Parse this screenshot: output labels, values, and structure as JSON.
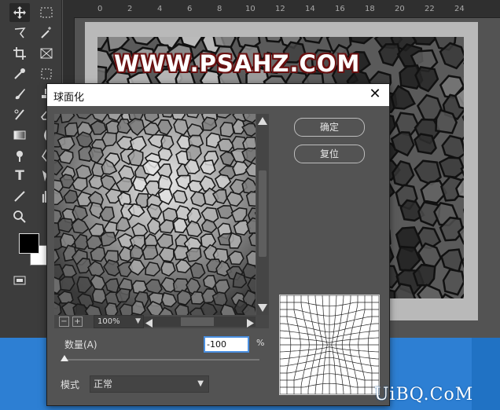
{
  "ruler": {
    "ticks": [
      "0",
      "2",
      "4",
      "6",
      "8",
      "10",
      "12",
      "14",
      "16",
      "18",
      "20",
      "22",
      "24"
    ]
  },
  "document": {
    "watermark": "WWW.PSAHZ.COM"
  },
  "dialog": {
    "title": "球面化",
    "close_label": "✕",
    "ok_label": "确定",
    "reset_label": "复位",
    "zoom_minus": "−",
    "zoom_plus": "+",
    "zoom_value": "100%",
    "amount_label": "数量(A)",
    "amount_value": "-100",
    "amount_unit": "%",
    "amount_level": -100,
    "mode_label": "模式",
    "mode_value": "正常"
  },
  "site_watermark": "UiBQ.CoM",
  "icons": [
    "move-icon",
    "marquee-icon",
    "lasso-icon",
    "magic-wand-icon",
    "crop-icon",
    "frame-icon",
    "eyedropper-icon",
    "healing-icon",
    "brush-icon",
    "stamp-icon",
    "history-brush-icon",
    "eraser-icon",
    "gradient-icon",
    "blur-icon",
    "dodge-icon",
    "pen-icon",
    "type-icon",
    "path-select-icon",
    "line-icon",
    "hand-icon",
    "zoom-icon",
    "screen-mode-icon"
  ],
  "colors": {
    "foreground": "#000000",
    "background": "#ffffff",
    "accent": "#4a8fe0",
    "taskbar": "#2d7fd3"
  }
}
